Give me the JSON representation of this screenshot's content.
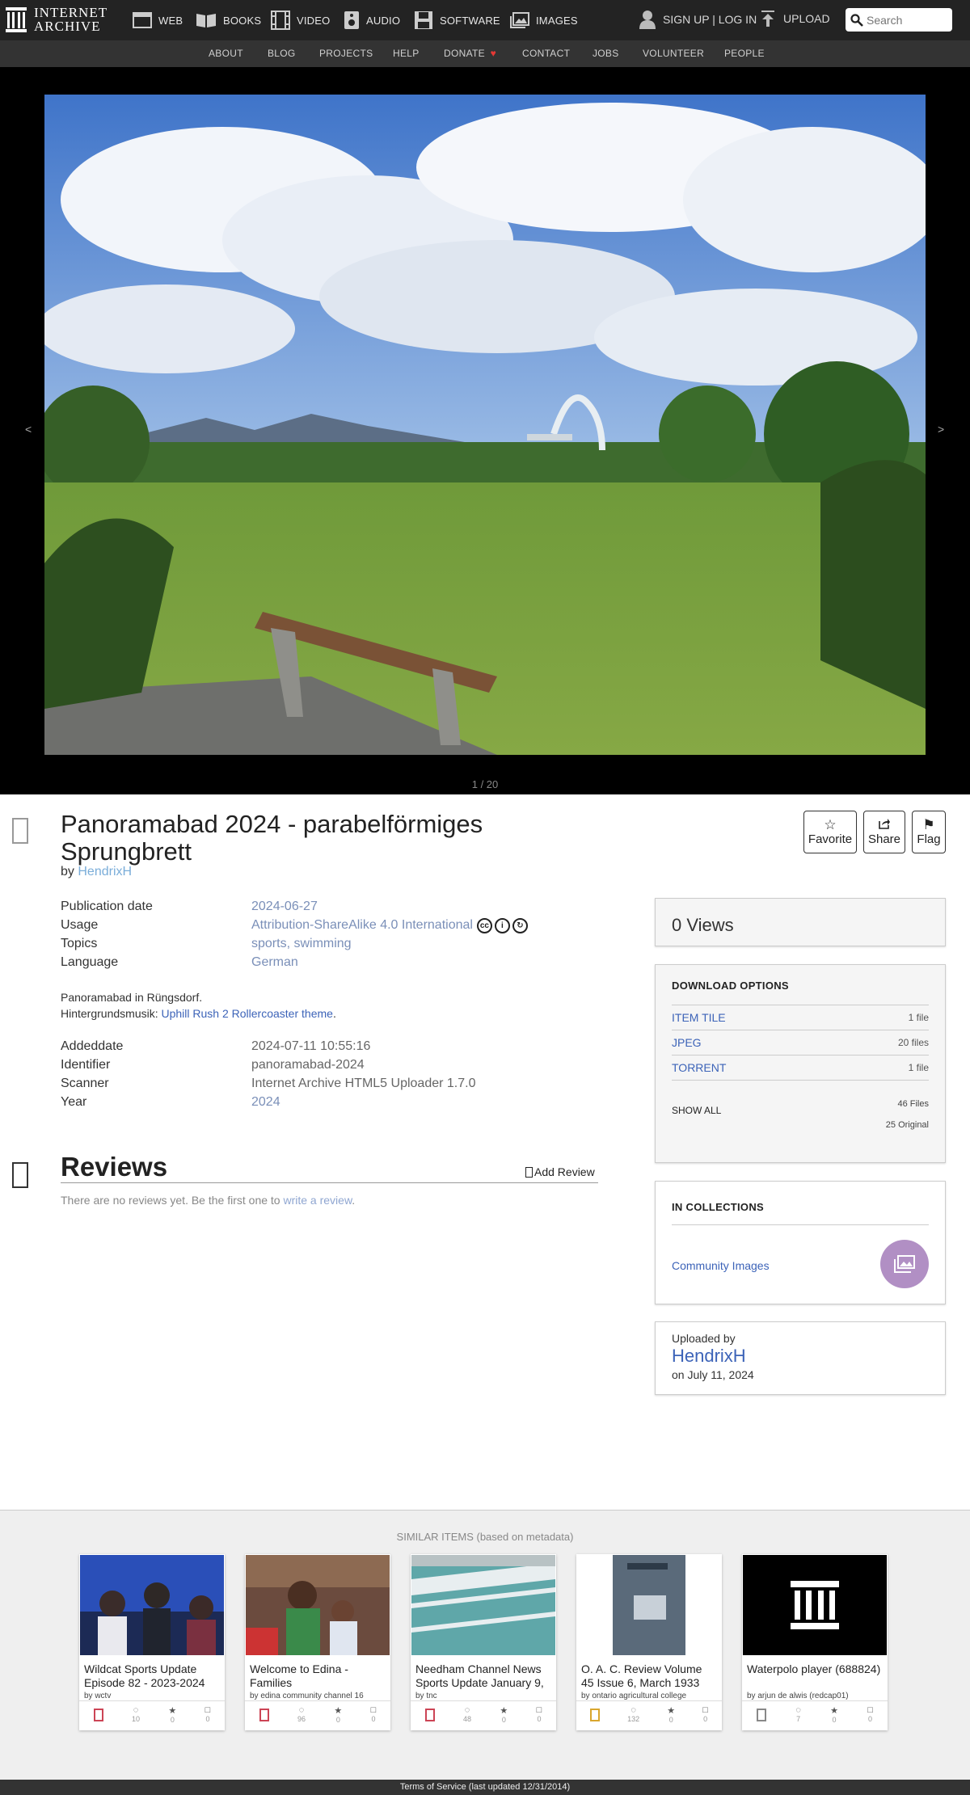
{
  "brand": {
    "line1": "INTERNET",
    "line2": "ARCHIVE"
  },
  "topnav": [
    {
      "label": "WEB",
      "icon": "web-icon"
    },
    {
      "label": "BOOKS",
      "icon": "books-icon"
    },
    {
      "label": "VIDEO",
      "icon": "video-icon"
    },
    {
      "label": "AUDIO",
      "icon": "audio-icon"
    },
    {
      "label": "SOFTWARE",
      "icon": "software-icon"
    },
    {
      "label": "IMAGES",
      "icon": "images-icon"
    }
  ],
  "account": {
    "signup_label": "SIGN UP | LOG IN",
    "upload_label": "UPLOAD"
  },
  "search": {
    "placeholder": "Search"
  },
  "subnav": [
    "ABOUT",
    "BLOG",
    "PROJECTS",
    "HELP",
    "DONATE",
    "CONTACT",
    "JOBS",
    "VOLUNTEER",
    "PEOPLE"
  ],
  "viewer": {
    "counter": "1 / 20",
    "prev_glyph": "<",
    "next_glyph": ">"
  },
  "item": {
    "title": "Panoramabad 2024 - parabelförmiges Sprungbrett",
    "by_prefix": "by",
    "creator": "HendrixH",
    "actions": {
      "favorite": "Favorite",
      "share": "Share",
      "flag": "Flag"
    }
  },
  "metadata": {
    "publication_date": {
      "key": "Publication date",
      "value": "2024-06-27"
    },
    "usage": {
      "key": "Usage",
      "value": "Attribution-ShareAlike 4.0 International"
    },
    "topics": {
      "key": "Topics",
      "value": "sports, swimming"
    },
    "language": {
      "key": "Language",
      "value": "German"
    },
    "description_line1": "Panoramabad in Rüngsdorf.",
    "description_prefix": "Hintergrundsmusik: ",
    "description_link": "Uphill Rush 2 Rollercoaster theme",
    "description_suffix": ".",
    "addeddate": {
      "key": "Addeddate",
      "value": "2024-07-11 10:55:16"
    },
    "identifier": {
      "key": "Identifier",
      "value": "panoramabad-2024"
    },
    "scanner": {
      "key": "Scanner",
      "value": "Internet Archive HTML5 Uploader 1.7.0"
    },
    "year": {
      "key": "Year",
      "value": "2024"
    }
  },
  "reviews": {
    "title": "Reviews",
    "add_label": "Add Review",
    "empty_prefix": "There are no reviews yet. Be the first one to ",
    "empty_link": "write a review",
    "empty_suffix": "."
  },
  "sidebar": {
    "views": "0 Views",
    "download_heading": "DOWNLOAD OPTIONS",
    "downloads": [
      {
        "format": "ITEM TILE",
        "count": "1 file"
      },
      {
        "format": "JPEG",
        "count": "20 files"
      },
      {
        "format": "TORRENT",
        "count": "1 file"
      }
    ],
    "show_all": "SHOW ALL",
    "total_files": "46 Files",
    "original_files": "25 Original",
    "collections_heading": "IN COLLECTIONS",
    "collection": "Community Images",
    "uploaded_by_label": "Uploaded by",
    "uploader": "HendrixH",
    "uploaded_on": "on July 11, 2024"
  },
  "similar": {
    "heading": "SIMILAR ITEMS (based on metadata)",
    "items": [
      {
        "title": "Wildcat Sports Update Episode 82 - 2023-2024",
        "by": "by wctv",
        "views": "10",
        "favs": "0",
        "reviews": "0"
      },
      {
        "title": "Welcome to Edina - Families",
        "by": "by edina community channel 16",
        "views": "96",
        "favs": "0",
        "reviews": "0"
      },
      {
        "title": "Needham Channel News Sports Update January 9,",
        "by": "by tnc",
        "views": "48",
        "favs": "0",
        "reviews": "0"
      },
      {
        "title": "O. A. C. Review Volume 45 Issue 6, March 1933",
        "by": "by ontario agricultural college",
        "views": "132",
        "favs": "0",
        "reviews": "0"
      },
      {
        "title": "Waterpolo player (688824)",
        "by": "by arjun de alwis (redcap01)",
        "views": "7",
        "favs": "0",
        "reviews": "0"
      }
    ]
  },
  "footer": "Terms of Service (last updated 12/31/2014)",
  "colors": {
    "topbar": "#232323",
    "subnav": "#333333",
    "link": "#3c63b8",
    "collection_icon": "#b18fc4"
  }
}
